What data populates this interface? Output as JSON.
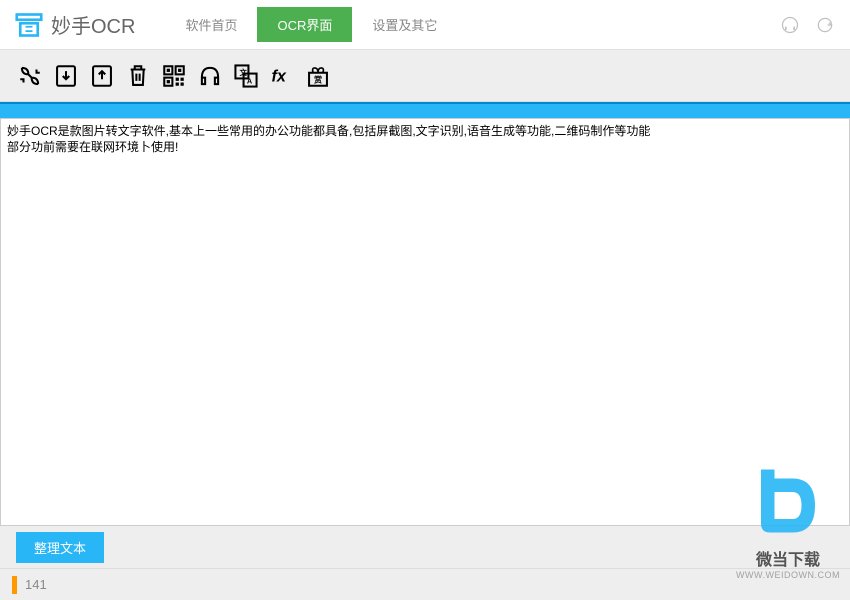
{
  "header": {
    "app_name": "妙手OCR",
    "tabs": [
      {
        "label": "软件首页",
        "active": false
      },
      {
        "label": "OCR界面",
        "active": true
      },
      {
        "label": "设置及其它",
        "active": false
      }
    ]
  },
  "toolbar": {
    "icons": [
      "screenshot-icon",
      "import-icon",
      "export-icon",
      "delete-icon",
      "qrcode-icon",
      "headphones-icon",
      "translate-icon",
      "fx-icon",
      "reward-icon"
    ]
  },
  "content": {
    "text": "妙手OCR是款图片转文字软件,基本上一些常用的办公功能都具备,包括屏截图,文字识别,语音生成等功能,二维码制作等功能\n部分功前需要在联网环境卜使用!"
  },
  "bottom": {
    "organize_label": "整理文本"
  },
  "status": {
    "value": "141"
  },
  "watermark": {
    "title": "微当下载",
    "url": "WWW.WEIDOWN.COM"
  }
}
